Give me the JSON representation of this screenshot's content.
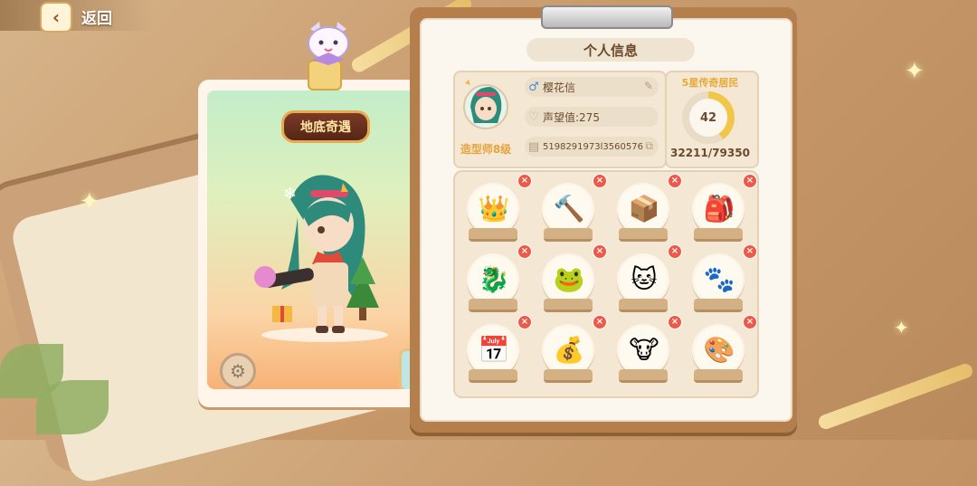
{
  "header": {
    "back_label": "返回"
  },
  "card": {
    "badge": "地底奇遇"
  },
  "panel": {
    "title": "个人信息",
    "name": "樱花信",
    "fame": "声望值:275",
    "uid": "5198291973l3560576",
    "stylist_level": "造型师8级",
    "rank_title": "5星传奇居民",
    "level": "42",
    "exp": "32211/79350",
    "exp_progress": 0.406
  },
  "items": [
    {
      "icon": "crown-cushion-icon",
      "glyph": "👑"
    },
    {
      "icon": "crystal-hammer-icon",
      "glyph": "🔨"
    },
    {
      "icon": "gold-box-icon",
      "glyph": "📦"
    },
    {
      "icon": "backpack-icon",
      "glyph": "🎒"
    },
    {
      "icon": "golden-dragon-icon",
      "glyph": "🐉"
    },
    {
      "icon": "green-frog-icon",
      "glyph": "🐸"
    },
    {
      "icon": "hello-cat-icon",
      "glyph": "🐱"
    },
    {
      "icon": "blue-cat-icon",
      "glyph": "🐾"
    },
    {
      "icon": "calendar-icon",
      "glyph": "📅"
    },
    {
      "icon": "coin-stack-icon",
      "glyph": "💰"
    },
    {
      "icon": "cow-field-icon",
      "glyph": "🐮"
    },
    {
      "icon": "paint-canvas-icon",
      "glyph": "🎨"
    }
  ]
}
